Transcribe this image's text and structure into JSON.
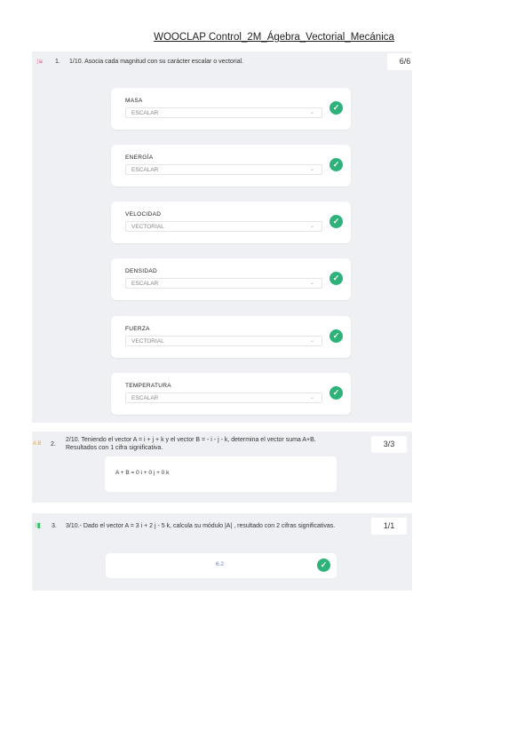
{
  "document": {
    "title": "WOOCLAP Control_2M_Ágebra_Vectorial_Mecánica"
  },
  "q1": {
    "number": "1.",
    "prompt": "1/10. Asocia cada magnitud con su carácter escalar o vectorial.",
    "score": "6/6",
    "icon": "list-icon",
    "items": [
      {
        "label": "MASA",
        "value": "ESCALAR"
      },
      {
        "label": "ENERGÍA",
        "value": "ESCALAR"
      },
      {
        "label": "VELOCIDAD",
        "value": "VECTORIAL"
      },
      {
        "label": "DENSIDAD",
        "value": "ESCALAR"
      },
      {
        "label": "FUERZA",
        "value": "VECTORIAL"
      },
      {
        "label": "TEMPERATURA",
        "value": "ESCALAR"
      }
    ]
  },
  "q2": {
    "number": "2.",
    "prompt_line1": "2/10. Teniendo el vector A = i + j + k y el vector B = - i - j - k, determina el vector suma A+B.",
    "prompt_line2": "Resultados con 1 cifra significativa.",
    "score": "3/3",
    "icon_text": "A B",
    "answer": "A + B = 0 i + 0 j + 0 k"
  },
  "q3": {
    "number": "3.",
    "prompt": "3/10.- Dado el vector A = 3 i + 2 j - 5 k, calcula su módulo |A| , resultado con 2 cifras significativas.",
    "score": "1/1",
    "answer": "6.2"
  },
  "colors": {
    "accent": "#2db37a",
    "panel": "#eef0f3"
  }
}
